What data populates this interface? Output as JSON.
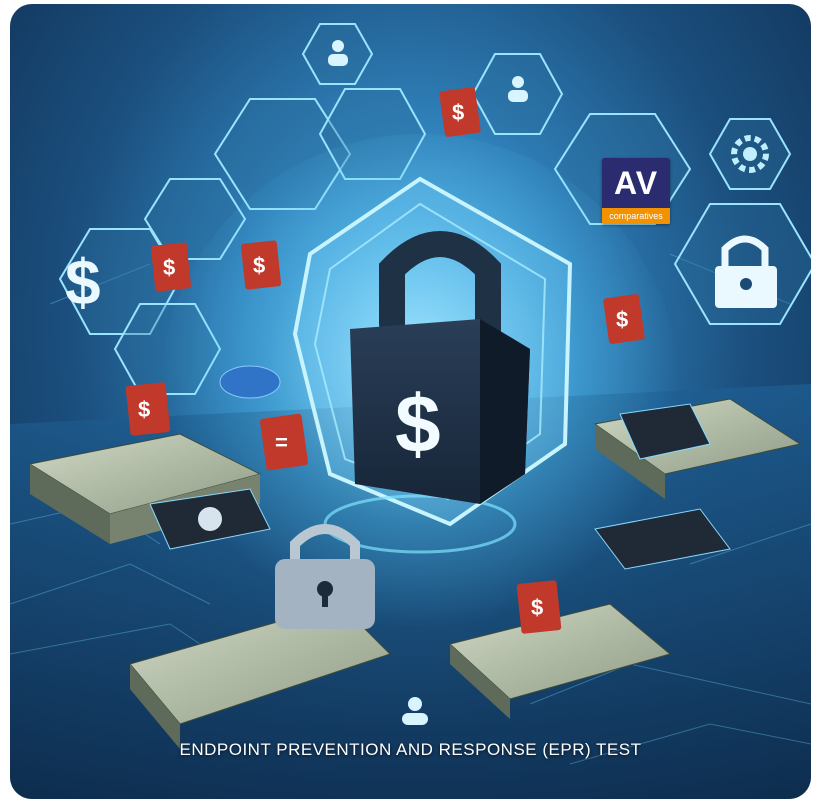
{
  "badge": {
    "brand": "AV",
    "subtitle": "comparatives"
  },
  "caption": "ENDPOINT PREVENTION AND RESPONSE (EPR) TEST",
  "colors": {
    "accent_blue": "#5fd0ff",
    "badge_navy": "#2b2b70",
    "badge_orange": "#f29200",
    "tag_red": "#c0392b"
  },
  "icons": [
    "padlock-icon",
    "dollar-sign-icon",
    "shield-icon",
    "cash-stack-icon",
    "user-icon",
    "lock-icon",
    "gear-icon"
  ]
}
